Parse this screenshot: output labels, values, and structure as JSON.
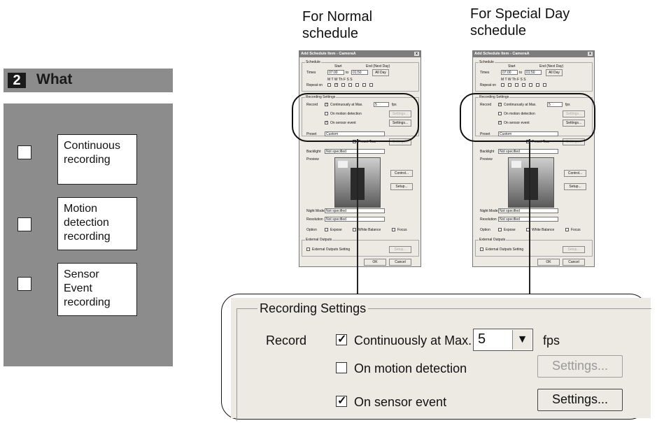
{
  "left": {
    "step_number": "2",
    "step_title": "What",
    "options": [
      {
        "label": "Continuous recording"
      },
      {
        "label": "Motion detection recording"
      },
      {
        "label": "Sensor Event recording"
      }
    ]
  },
  "captions": {
    "normal": "For Normal schedule",
    "special": "For Special Day schedule"
  },
  "dialog": {
    "title": "Add Schedule Item - CameraA",
    "close": "x",
    "schedule_legend": "Schedule",
    "start_label": "Start",
    "end_label": "End (Next Day)",
    "times_label": "Times",
    "start_time": "07:00",
    "to_label": "to",
    "end_time": "01:50",
    "all_day": "All Day",
    "days_label": "M   T   W  Th  F   S   S",
    "repeat_label": "Repeat on",
    "recording_legend": "Recording Settings",
    "record_label": "Record",
    "continuous_label": "Continuously at Max.",
    "fps_value": "5",
    "fps_label": "fps",
    "motion_label": "On motion detection",
    "sensor_label": "On sensor event",
    "settings_btn": "Settings...",
    "preset_label": "Preset",
    "preset_value": "Custom",
    "preset_tour": "Preset Tour",
    "backlight_label": "Backlight",
    "not_specified": "Not specified",
    "preview_label": "Preview",
    "control_btn": "Control...",
    "setup_btn": "Setup...",
    "night_label": "Night Mode",
    "resolution_label": "Resolution",
    "option_label": "Option",
    "expose": "Expose",
    "white_balance": "White Balance",
    "focus": "Focus",
    "ext_legend": "External Outputs",
    "ext_label": "External Outputs Setting",
    "ok_btn": "OK",
    "cancel_btn": "Cancel"
  },
  "zoom": {
    "legend": "Recording Settings",
    "record_label": "Record",
    "continuous_label": "Continuously at Max.",
    "fps_value": "5",
    "fps_label": "fps",
    "motion_label": "On motion detection",
    "sensor_label": "On sensor event",
    "settings_disabled": "Settings...",
    "settings_enabled": "Settings..."
  }
}
